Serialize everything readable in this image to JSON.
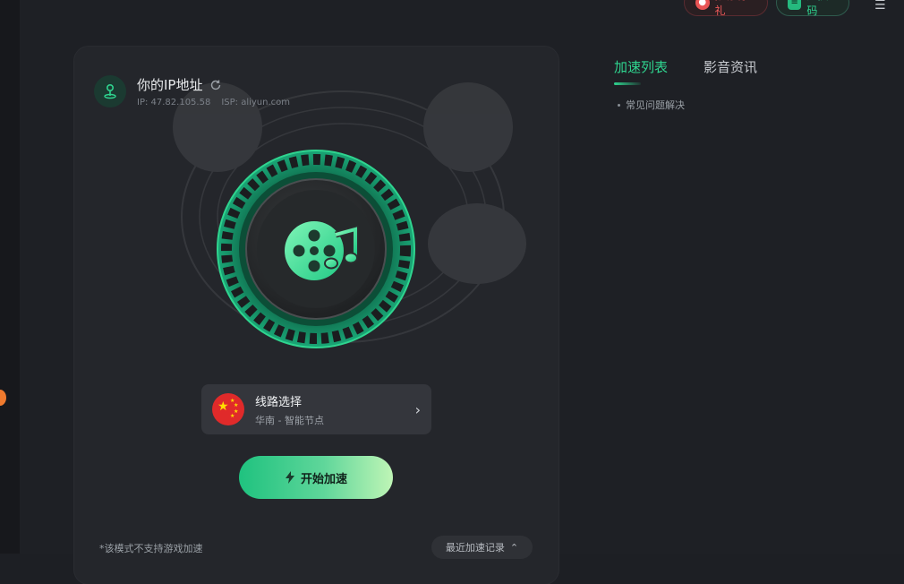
{
  "header": {
    "recommend_label": "推荐有礼",
    "redeem_label": "兑换码"
  },
  "ip_panel": {
    "title": "你的IP地址",
    "ip_label": "IP: 47.82.105.58",
    "isp_label": "ISP: aliyun.com"
  },
  "route": {
    "title": "线路选择",
    "subtitle": "华南 - 智能节点"
  },
  "actions": {
    "start_label": "开始加速",
    "recent_label": "最近加速记录"
  },
  "note": "*该模式不支持游戏加速",
  "tabs": [
    {
      "label": "加速列表",
      "active": true
    },
    {
      "label": "影音资讯",
      "active": false
    }
  ],
  "faq_item": "常见问题解决",
  "colors": {
    "accent": "#2fd48f",
    "recommend": "#f05a5a",
    "background": "#1e2025",
    "card": "#24262b"
  }
}
